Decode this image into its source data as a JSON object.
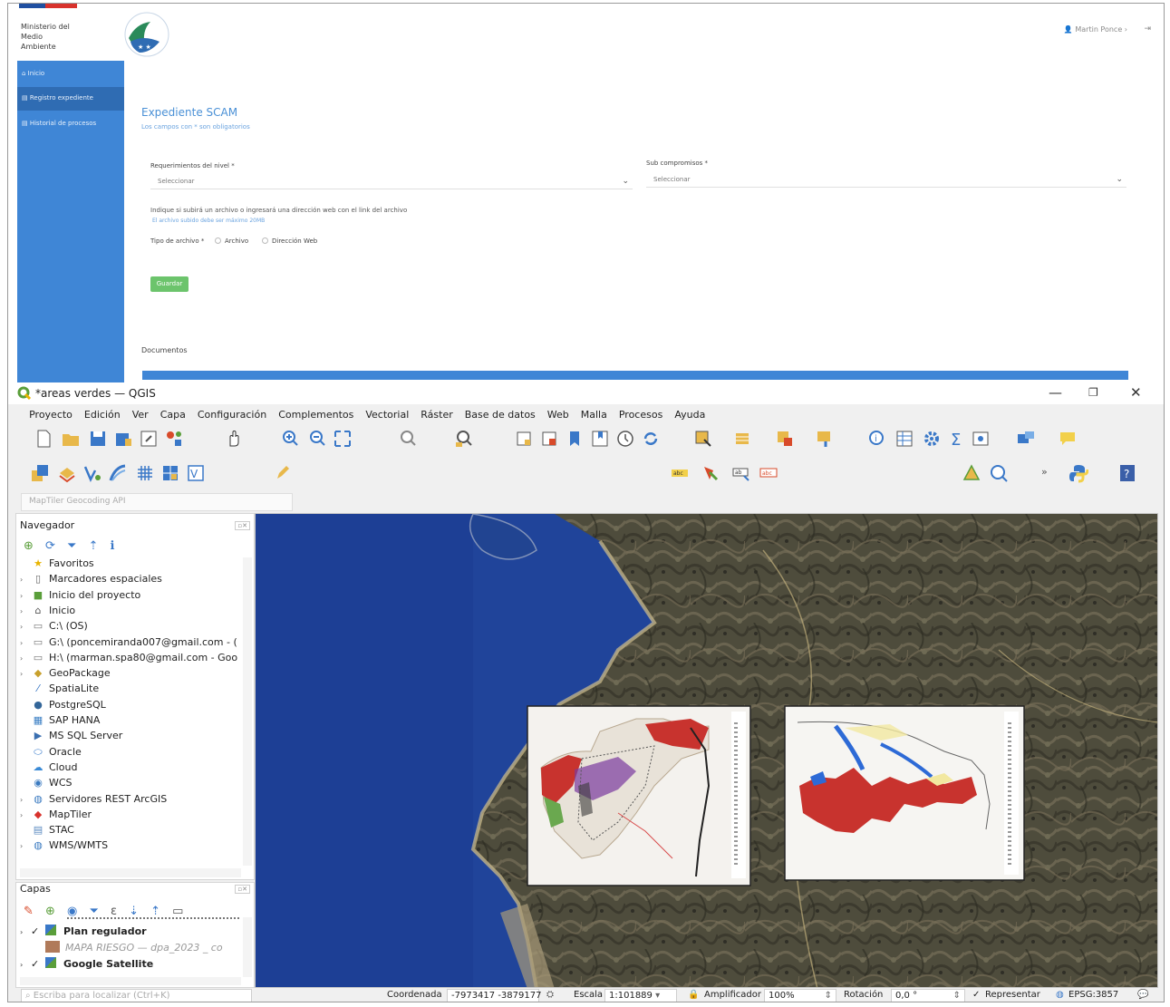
{
  "web": {
    "ministry_name": "Ministerio del\nMedio\nAmbiente",
    "user_label": "Martin Ponce",
    "sidebar": [
      {
        "label": "Inicio"
      },
      {
        "label": "Registro expediente"
      },
      {
        "label": "Historial de procesos"
      }
    ],
    "form": {
      "title": "Expediente SCAM",
      "subtitle": "Los campos con * son obligatorios",
      "req_label": "Requerimientos del nivel *",
      "req_value": "Seleccionar",
      "sub_label": "Sub compromisos *",
      "sub_value": "Seleccionar",
      "hint": "Indique si subirá un archivo o ingresará una dirección web con el link del archivo",
      "hint_small": "El archivo subido debe ser máximo 20MB",
      "tipo_label": "Tipo de archivo *",
      "option_file": "Archivo",
      "option_web": "Dirección Web",
      "save_label": "Guardar"
    },
    "documents_label": "Documentos"
  },
  "qgis": {
    "window_title": "*areas verdes — QGIS",
    "menu": [
      "Proyecto",
      "Edición",
      "Ver",
      "Capa",
      "Configuración",
      "Complementos",
      "Vectorial",
      "Ráster",
      "Base de datos",
      "Web",
      "Malla",
      "Procesos",
      "Ayuda"
    ],
    "locator_placeholder": "MapTiler Geocoding API",
    "browser_title": "Navegador",
    "browser_items": [
      {
        "label": "Favoritos",
        "icon": "star-icon",
        "glyph": "★",
        "color": "#e8b400",
        "expand": false
      },
      {
        "label": "Marcadores espaciales",
        "icon": "bookmark-icon",
        "glyph": "▯",
        "color": "#666",
        "expand": true
      },
      {
        "label": "Inicio del proyecto",
        "icon": "project-home-icon",
        "glyph": "■",
        "color": "#5a9e3a",
        "expand": true
      },
      {
        "label": "Inicio",
        "icon": "home-folder-icon",
        "glyph": "⌂",
        "color": "#555",
        "expand": true
      },
      {
        "label": "C:\\ (OS)",
        "icon": "drive-icon",
        "glyph": "▭",
        "color": "#777",
        "expand": true
      },
      {
        "label": "G:\\ (poncemiranda007@gmail.com - (",
        "icon": "drive-icon",
        "glyph": "▭",
        "color": "#777",
        "expand": true
      },
      {
        "label": "H:\\ (marman.spa80@gmail.com - Goo",
        "icon": "drive-icon",
        "glyph": "▭",
        "color": "#777",
        "expand": true
      },
      {
        "label": "GeoPackage",
        "icon": "geopackage-icon",
        "glyph": "◆",
        "color": "#c8a02c",
        "expand": true
      },
      {
        "label": "SpatiaLite",
        "icon": "spatialite-icon",
        "glyph": "⁄",
        "color": "#2e6fc0",
        "expand": false
      },
      {
        "label": "PostgreSQL",
        "icon": "postgresql-icon",
        "glyph": "●",
        "color": "#336699",
        "expand": false
      },
      {
        "label": "SAP HANA",
        "icon": "saphana-icon",
        "glyph": "▦",
        "color": "#3b7fc4",
        "expand": false
      },
      {
        "label": "MS SQL Server",
        "icon": "mssql-icon",
        "glyph": "▶",
        "color": "#3a6fb0",
        "expand": false
      },
      {
        "label": "Oracle",
        "icon": "oracle-icon",
        "glyph": "⬭",
        "color": "#2d73c8",
        "expand": false
      },
      {
        "label": "Cloud",
        "icon": "cloud-icon",
        "glyph": "☁",
        "color": "#3a8ad6",
        "expand": false
      },
      {
        "label": "WCS",
        "icon": "wcs-icon",
        "glyph": "◉",
        "color": "#3a7ac0",
        "expand": false
      },
      {
        "label": "Servidores REST ArcGIS",
        "icon": "arcgis-icon",
        "glyph": "◍",
        "color": "#3a7ac0",
        "expand": true
      },
      {
        "label": "MapTiler",
        "icon": "maptiler-icon",
        "glyph": "◆",
        "color": "#d8322c",
        "expand": true
      },
      {
        "label": "STAC",
        "icon": "stac-icon",
        "glyph": "▤",
        "color": "#5a8ac0",
        "expand": false
      },
      {
        "label": "WMS/WMTS",
        "icon": "wms-icon",
        "glyph": "◍",
        "color": "#3a7ac0",
        "expand": true
      }
    ],
    "layers_title": "Capas",
    "layers": [
      {
        "label": "Plan regulador",
        "checked": "✓",
        "icon": "group-icon",
        "bold": true
      },
      {
        "label": "MAPA RIESGO — dpa_2023 _ co",
        "checked": "",
        "icon": "raster-swatch-icon",
        "bold": false
      },
      {
        "label": "Google Satellite",
        "checked": "✓",
        "icon": "group-icon",
        "bold": true
      }
    ],
    "locate_placeholder": "Escriba para localizar (Ctrl+K)",
    "status": {
      "coord_label": "Coordenada",
      "coord_value": "-7973417 -3879177",
      "scale_label": "Escala",
      "scale_value": "1:101889",
      "magnifier_label": "Amplificador",
      "magnifier_value": "100%",
      "rotation_label": "Rotación",
      "rotation_value": "0,0 °",
      "render_label": "Representar",
      "render_check": "✓",
      "crs": "EPSG:3857"
    }
  }
}
